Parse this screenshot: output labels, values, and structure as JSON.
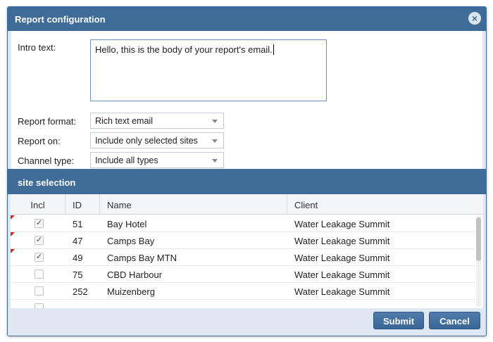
{
  "dialog": {
    "title": "Report configuration",
    "close_glyph": "×",
    "close_icon": "close-icon"
  },
  "form": {
    "intro_label": "Intro text:",
    "intro_value": "Hello, this is the body of your report's email.",
    "format_label": "Report format:",
    "format_value": "Rich text email",
    "report_on_label": "Report on:",
    "report_on_value": "Include only selected sites",
    "channel_label": "Channel type:",
    "channel_value": "Include all types"
  },
  "section": {
    "title": "site selection"
  },
  "grid": {
    "columns": [
      "Incl",
      "ID",
      "Name",
      "Client"
    ],
    "rows": [
      {
        "checked": "✓",
        "id": "51",
        "name": "Bay Hotel",
        "client": "Water Leakage Summit"
      },
      {
        "checked": "✓",
        "id": "47",
        "name": "Camps Bay",
        "client": "Water Leakage Summit"
      },
      {
        "checked": "✓",
        "id": "49",
        "name": "Camps Bay MTN",
        "client": "Water Leakage Summit"
      },
      {
        "checked": "",
        "id": "75",
        "name": "CBD Harbour",
        "client": "Water Leakage Summit"
      },
      {
        "checked": "",
        "id": "252",
        "name": "Muizenberg",
        "client": "Water Leakage Summit"
      }
    ]
  },
  "buttons": {
    "submit": "Submit",
    "cancel": "Cancel"
  },
  "colors": {
    "header": "#3f6b99",
    "dirty_marker": "#d9221c"
  }
}
